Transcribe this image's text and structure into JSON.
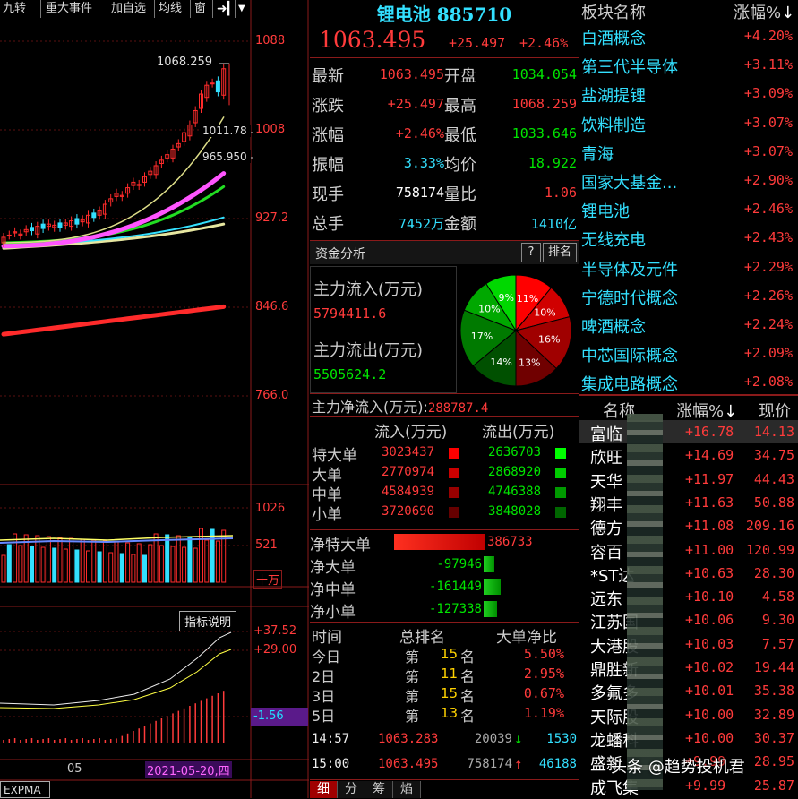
{
  "toolbar": {
    "items": [
      "九转",
      "重大事件",
      "加自选",
      "均线",
      "窗"
    ],
    "extra_icon": "exit-icon",
    "dropdown_icon": "triangle-down-icon"
  },
  "chart": {
    "price_axis": [
      "1088",
      "1008",
      "927.2",
      "846.6",
      "766.0"
    ],
    "high_label": "1068.259",
    "mid_label_a": "1011.78",
    "mid_label_b": "965.950",
    "vol_axis": [
      "1026",
      "521"
    ],
    "vol_unit": "十万",
    "indicator_button": "指标说明",
    "ind_axis": [
      "+37.52",
      "+29.00",
      "-1.56"
    ],
    "month_label": "05",
    "date_label": "2021-05-20,四",
    "indicator_name": "EXPMA",
    "colors": {
      "up": "#ff2b2b",
      "down": "#33e0ff",
      "ma_pink": "#ff55ff",
      "ma_green": "#22dd22",
      "ma_yellow": "#e6e6a0",
      "ma_red": "#ff2b2b"
    }
  },
  "quote": {
    "title": "锂电池 885710",
    "price": "1063.495",
    "change": "+25.497",
    "change_pct": "+2.46%",
    "rows": [
      {
        "l1": "最新",
        "v1": "1063.495",
        "l2": "开盘",
        "v2": "1034.054",
        "c1": "red",
        "c2": "green"
      },
      {
        "l1": "涨跌",
        "v1": "+25.497",
        "l2": "最高",
        "v2": "1068.259",
        "c1": "red",
        "c2": "red"
      },
      {
        "l1": "涨幅",
        "v1": "+2.46%",
        "l2": "最低",
        "v2": "1033.646",
        "c1": "red",
        "c2": "green"
      },
      {
        "l1": "振幅",
        "v1": "3.33%",
        "l2": "均价",
        "v2": "18.922",
        "c1": "cyan",
        "c2": "green"
      },
      {
        "l1": "现手",
        "v1": "758174",
        "l2": "量比",
        "v2": "1.06",
        "c1": "white",
        "c2": "red"
      },
      {
        "l1": "总手",
        "v1": "7452万",
        "l2": "金额",
        "v2": "1410亿",
        "c1": "cyan",
        "c2": "cyan"
      }
    ]
  },
  "fund": {
    "header": "资金分析",
    "help": "?",
    "rank_btn": "排名",
    "inflow_label": "主力流入(万元)",
    "inflow_value": "5794411.6",
    "outflow_label": "主力流出(万元)",
    "outflow_value": "5505624.2",
    "net_label": "主力净流入(万元):",
    "net_value": "288787.4",
    "pie": [
      {
        "label": "11%",
        "value": 11,
        "color": "#ff0000"
      },
      {
        "label": "10%",
        "value": 10,
        "color": "#d00000"
      },
      {
        "label": "16%",
        "value": 16,
        "color": "#a00000"
      },
      {
        "label": "13%",
        "value": 13,
        "color": "#700000"
      },
      {
        "label": "14%",
        "value": 14,
        "color": "#005000"
      },
      {
        "label": "17%",
        "value": 17,
        "color": "#007a00"
      },
      {
        "label": "10%",
        "value": 10,
        "color": "#00a800"
      },
      {
        "label": "9%",
        "value": 9,
        "color": "#00d800"
      }
    ],
    "flow_headers": [
      "流入(万元)",
      "流出(万元)"
    ],
    "flow_rows": [
      {
        "name": "特大单",
        "in": "3023437",
        "out": "2636703"
      },
      {
        "name": "大单",
        "in": "2770974",
        "out": "2868920"
      },
      {
        "name": "中单",
        "in": "4584939",
        "out": "4746388"
      },
      {
        "name": "小单",
        "in": "3720690",
        "out": "3848028"
      }
    ],
    "net_rows": [
      {
        "name": "净特大单",
        "value": "386733",
        "v": 386733
      },
      {
        "name": "净大单",
        "value": "-97946",
        "v": -97946
      },
      {
        "name": "净中单",
        "value": "-161449",
        "v": -161449
      },
      {
        "name": "净小单",
        "value": "-127338",
        "v": -127338
      }
    ],
    "rank_headers": [
      "时间",
      "总排名",
      "大单净比"
    ],
    "rank_rows": [
      {
        "t": "今日",
        "pre": "第",
        "n": "15",
        "suf": "名",
        "pct": "5.50%"
      },
      {
        "t": "2日",
        "pre": "第",
        "n": "11",
        "suf": "名",
        "pct": "2.95%"
      },
      {
        "t": "3日",
        "pre": "第",
        "n": "15",
        "suf": "名",
        "pct": "0.67%"
      },
      {
        "t": "5日",
        "pre": "第",
        "n": "13",
        "suf": "名",
        "pct": "1.19%"
      }
    ],
    "ticks": [
      {
        "time": "14:57",
        "price": "1063.283",
        "vol": "20039",
        "flag": "↓",
        "n": "1530"
      },
      {
        "time": "15:00",
        "price": "1063.495",
        "vol": "758174",
        "flag": "↑",
        "n": "46188"
      }
    ],
    "bottom_tabs": [
      "细",
      "分",
      "筹",
      "焰"
    ]
  },
  "sectors": {
    "header_name": "板块名称",
    "header_pct": "涨幅%",
    "rows": [
      {
        "name": "白酒概念",
        "pct": "+4.20%"
      },
      {
        "name": "第三代半导体",
        "pct": "+3.11%"
      },
      {
        "name": "盐湖提锂",
        "pct": "+3.09%"
      },
      {
        "name": "饮料制造",
        "pct": "+3.07%"
      },
      {
        "name": "青海",
        "pct": "+3.07%"
      },
      {
        "name": "国家大基金...",
        "pct": "+2.90%"
      },
      {
        "name": "锂电池",
        "pct": "+2.46%"
      },
      {
        "name": "无线充电",
        "pct": "+2.43%"
      },
      {
        "name": "半导体及元件",
        "pct": "+2.29%"
      },
      {
        "name": "宁德时代概念",
        "pct": "+2.26%"
      },
      {
        "name": "啤酒概念",
        "pct": "+2.24%"
      },
      {
        "name": "中芯国际概念",
        "pct": "+2.09%"
      },
      {
        "name": "集成电路概念",
        "pct": "+2.08%"
      }
    ]
  },
  "stocks": {
    "header_name": "名称",
    "header_pct": "涨幅%",
    "header_price": "现价",
    "rows": [
      {
        "name": "富临",
        "pct": "+16.78",
        "price": "14.13"
      },
      {
        "name": "欣旺",
        "pct": "+14.69",
        "price": "34.75"
      },
      {
        "name": "天华",
        "pct": "+11.97",
        "price": "44.43"
      },
      {
        "name": "翔丰",
        "pct": "+11.63",
        "price": "50.88"
      },
      {
        "name": "德方",
        "pct": "+11.08",
        "price": "209.16"
      },
      {
        "name": "容百",
        "pct": "+11.00",
        "price": "120.99"
      },
      {
        "name": "*ST达",
        "pct": "+10.63",
        "price": "28.30"
      },
      {
        "name": "远东",
        "pct": "+10.10",
        "price": "4.58"
      },
      {
        "name": "江苏国",
        "pct": "+10.06",
        "price": "9.30"
      },
      {
        "name": "大港股",
        "pct": "+10.03",
        "price": "7.57"
      },
      {
        "name": "鼎胜新",
        "pct": "+10.02",
        "price": "19.44"
      },
      {
        "name": "多氟多",
        "pct": "+10.01",
        "price": "35.38"
      },
      {
        "name": "天际股",
        "pct": "+10.00",
        "price": "32.89"
      },
      {
        "name": "龙蟠科",
        "pct": "+10.00",
        "price": "30.37"
      },
      {
        "name": "盛新",
        "pct": "+9.99",
        "price": "28.95"
      },
      {
        "name": "成飞集",
        "pct": "+9.99",
        "price": "25.87"
      }
    ],
    "watermark": "头条 @趋势投机君"
  }
}
